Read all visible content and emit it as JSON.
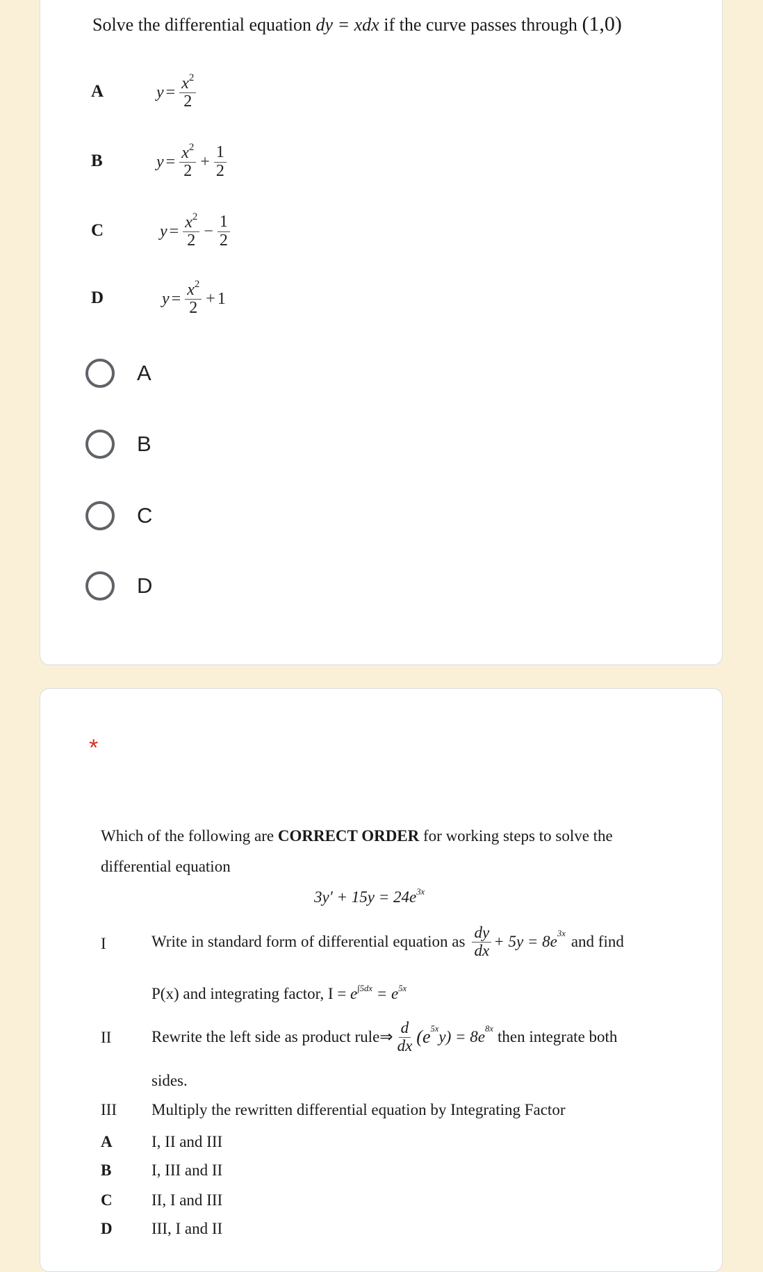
{
  "question1": {
    "title_prefix": "Solve the differential equation",
    "equation": {
      "lhs": "dy",
      "eq": "=",
      "rhs": "xdx"
    },
    "title_suffix": "if the curve passes through",
    "point": "(1,0)",
    "options": [
      {
        "letter": "A",
        "y": "y",
        "eq": "=",
        "num": "x",
        "exp": "2",
        "den": "2",
        "tail_op": "",
        "tail_num": "",
        "tail_den": "",
        "tail_const": ""
      },
      {
        "letter": "B",
        "y": "y",
        "eq": "=",
        "num": "x",
        "exp": "2",
        "den": "2",
        "tail_op": "+",
        "tail_num": "1",
        "tail_den": "2",
        "tail_const": ""
      },
      {
        "letter": "C",
        "y": "y",
        "eq": "=",
        "num": "x",
        "exp": "2",
        "den": "2",
        "tail_op": "−",
        "tail_num": "1",
        "tail_den": "2",
        "tail_const": ""
      },
      {
        "letter": "D",
        "y": "y",
        "eq": "=",
        "num": "x",
        "exp": "2",
        "den": "2",
        "tail_op": "+",
        "tail_num": "",
        "tail_den": "",
        "tail_const": "1"
      }
    ],
    "choices": [
      {
        "label": "A",
        "selected": false
      },
      {
        "label": "B",
        "selected": false
      },
      {
        "label": "C",
        "selected": false
      },
      {
        "label": "D",
        "selected": false
      }
    ]
  },
  "question2": {
    "required_marker": "*",
    "prompt_line1_a": "Which of the following are",
    "prompt_bold": "CORRECT ORDER",
    "prompt_line1_b": "for working steps to solve the",
    "prompt_line2": "differential equation",
    "equation": {
      "a": "3y′ + 15y = 24e",
      "exp": "3x"
    },
    "steps": [
      {
        "numeral": "I",
        "text_a": "Write in standard form of differential equation  as",
        "frac_num": "dy",
        "frac_den": "dx",
        "text_b": "+ 5y = 8e",
        "exp": "3x",
        "text_c": "and find",
        "line2_a": "P(x) and  integrating factor, I =",
        "line2_e": "e",
        "line2_int": "∫5dx",
        "line2_b": "= e",
        "line2_exp": "5x"
      },
      {
        "numeral": "II",
        "text_a": "Rewrite the left side as product rule⇒",
        "frac_num": "d",
        "frac_den": "dx",
        "paren_a": "(e",
        "paren_exp": "5x",
        "paren_b": "y) = 8e",
        "exp": "8x",
        "text_c": "then integrate both",
        "line2": "sides."
      },
      {
        "numeral": "III",
        "text": "Multiply the rewritten differential equation by Integrating Factor"
      }
    ],
    "answers": [
      {
        "letter": "A",
        "text": "I, II and III"
      },
      {
        "letter": "B",
        "text": "I, III and II"
      },
      {
        "letter": "C",
        "text": "II, I and III"
      },
      {
        "letter": "D",
        "text": "III, I and II"
      }
    ]
  },
  "colors": {
    "page_bg": "#faf0d8",
    "card_bg": "#ffffff",
    "card_border": "#dadce0",
    "radio": "#5f6368",
    "required": "#d93025"
  }
}
